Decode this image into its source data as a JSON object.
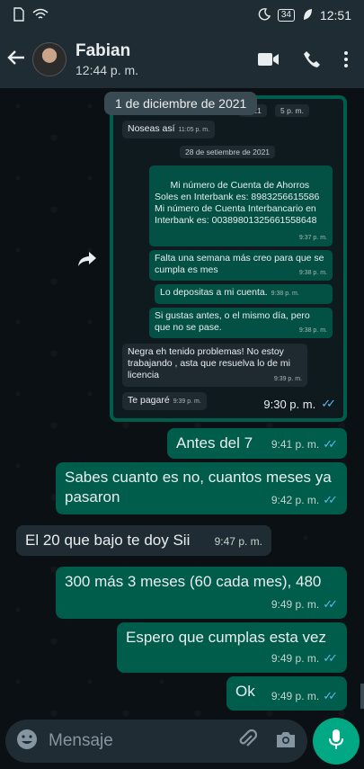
{
  "status_bar": {
    "time": "12:51",
    "battery": "34"
  },
  "header": {
    "name": "Fabian",
    "status": "12:44 p. m."
  },
  "forwarded_image": {
    "date_chip": "1 de diciembre de 2021",
    "top_partial_time": "5 p. m.",
    "top_partial_date": "2021",
    "first_msg": {
      "text": "Noseas así",
      "time": "11:05 p. m."
    },
    "inner_date": "28 de setiembre de 2021",
    "bank_msg": {
      "text": "Mi número de Cuenta de Ahorros Soles en Interbank es: 8983256615586\nMi número de Cuenta Interbancario en Interbank es: 00389801325661558648",
      "time": "9:37 p. m."
    },
    "msg2": {
      "text": "Falta una semana más creo para que se cumpla es mes",
      "time": "9:38 p. m."
    },
    "msg3": {
      "text": "Lo depositas a mi cuenta.",
      "time": "9:38 p. m."
    },
    "msg4": {
      "text": "Si gustas antes, o el mismo día, pero que no se pase.",
      "time": "9:38 p. m."
    },
    "msg5": {
      "text": "Negra eh tenido problemas! No estoy trabajando , asta que resuelva lo de mi licencia",
      "time": "9:39 p. m."
    },
    "msg6": {
      "text": "Te pagaré",
      "time": "9:39 p. m."
    },
    "sent_time": "9:30 p. m."
  },
  "messages": [
    {
      "text": "Antes del 7",
      "time": "9:41 p. m."
    },
    {
      "text": "Sabes cuanto es no, cuantos meses ya pasaron",
      "time": "9:42 p. m."
    },
    {
      "text": "El 20 que bajo te doy Sii",
      "time": "9:47 p. m."
    },
    {
      "text": "300 más 3 meses (60 cada mes), 480",
      "time": "9:49 p. m."
    },
    {
      "text": "Espero que cumplas esta vez",
      "time": "9:49 p. m."
    },
    {
      "text": "Ok",
      "time": "9:49 p. m."
    }
  ],
  "composer": {
    "placeholder": "Mensaje"
  },
  "colors": {
    "outgoing": "#005c4b",
    "incoming": "#202c33",
    "accent": "#00a884",
    "read_ticks": "#53bdeb"
  }
}
